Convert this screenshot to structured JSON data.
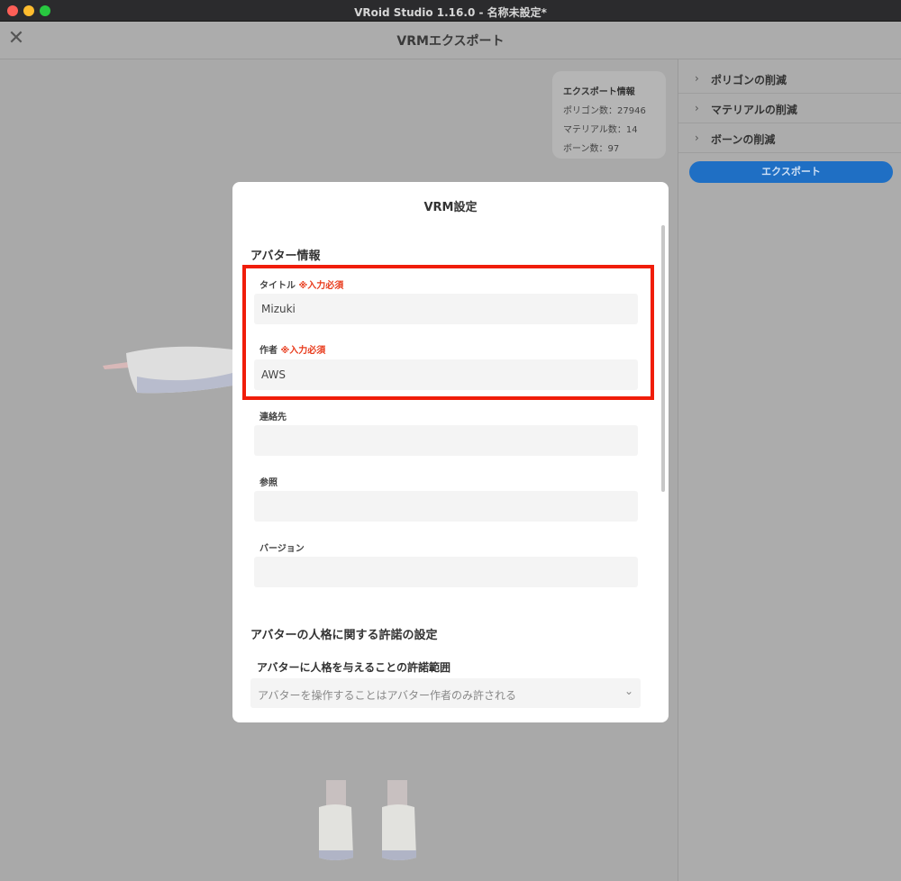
{
  "window": {
    "title": "VRoid Studio 1.16.0 - 名称未設定*"
  },
  "header": {
    "close_glyph": "✕",
    "title": "VRMエクスポート"
  },
  "export_info": {
    "title": "エクスポート情報",
    "polygons": "ポリゴン数：27946",
    "materials": "マテリアル数：14",
    "bones": "ボーン数：97"
  },
  "right_panel": {
    "items": [
      {
        "label": "ポリゴンの削減"
      },
      {
        "label": "マテリアルの削減"
      },
      {
        "label": "ボーンの削減"
      }
    ],
    "export_label": "エクスポート"
  },
  "modal": {
    "title": "VRM設定",
    "avatar_info_title": "アバター情報",
    "required_label": "※入力必須",
    "fields": {
      "title": {
        "label": "タイトル",
        "value": "Mizuki"
      },
      "author": {
        "label": "作者",
        "value": "AWS"
      },
      "contact": {
        "label": "連絡先",
        "value": ""
      },
      "reference": {
        "label": "参照",
        "value": ""
      },
      "version": {
        "label": "バージョン",
        "value": ""
      }
    },
    "personality_title": "アバターの人格に関する許諾の設定",
    "permission_label": "アバターに人格を与えることの許諾範囲",
    "permission_selected": "アバターを操作することはアバター作者のみ許される"
  },
  "colors": {
    "accent": "#1f6fc4",
    "required": "#e83a1b",
    "highlight": "#f01d0a"
  }
}
